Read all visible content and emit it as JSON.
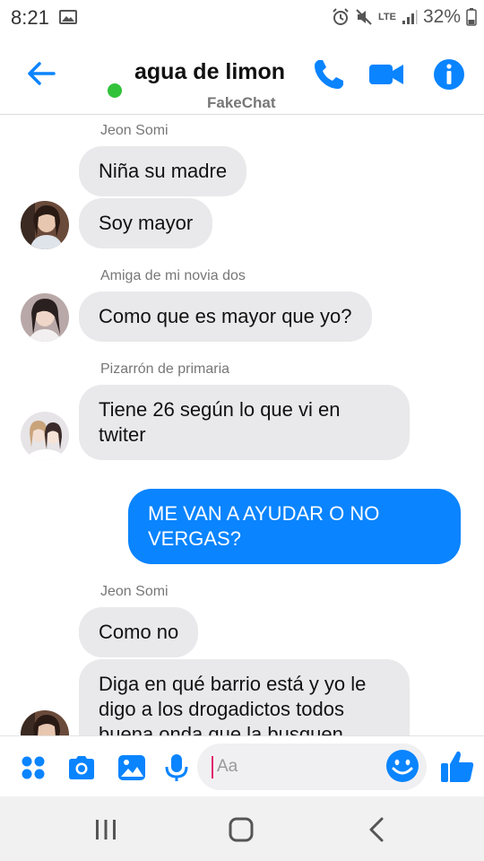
{
  "status_bar": {
    "time": "8:21",
    "battery": "32%",
    "network": "LTE",
    "icons": [
      "gallery-icon",
      "alarm-icon",
      "mute-icon",
      "lte-icon",
      "signal-icon",
      "battery-icon"
    ]
  },
  "header": {
    "title": "agua de limon",
    "subtitle": "FakeChat",
    "presence_color": "#31c23a",
    "accent_color": "#0a84ff",
    "icons": [
      "back-arrow-icon",
      "phone-icon",
      "video-camera-icon",
      "info-icon"
    ]
  },
  "messages": [
    {
      "sender": "Jeon Somi",
      "direction": "incoming",
      "lines": [
        "Niña su madre",
        "Soy mayor"
      ]
    },
    {
      "sender": "Amiga de mi novia dos",
      "direction": "incoming",
      "text": "Como que es mayor que yo?"
    },
    {
      "sender": "Pizarrón de primaria",
      "direction": "incoming",
      "text": "Tiene 26 según lo que vi en twiter"
    },
    {
      "direction": "outgoing",
      "text": "ME VAN A AYUDAR O NO VERGAS?"
    },
    {
      "sender": "Jeon Somi",
      "direction": "incoming",
      "lines": [
        "Como no",
        "Diga en qué barrio está y yo le digo a los drogadictos todos buena onda que la busquen"
      ]
    }
  ],
  "composer": {
    "placeholder": "Aa",
    "icons": [
      "apps-icon",
      "camera-icon",
      "gallery-icon",
      "microphone-icon",
      "emoji-icon",
      "thumbs-up-icon"
    ]
  },
  "nav_bar": {
    "icons": [
      "recents-icon",
      "home-icon",
      "back-icon"
    ]
  }
}
